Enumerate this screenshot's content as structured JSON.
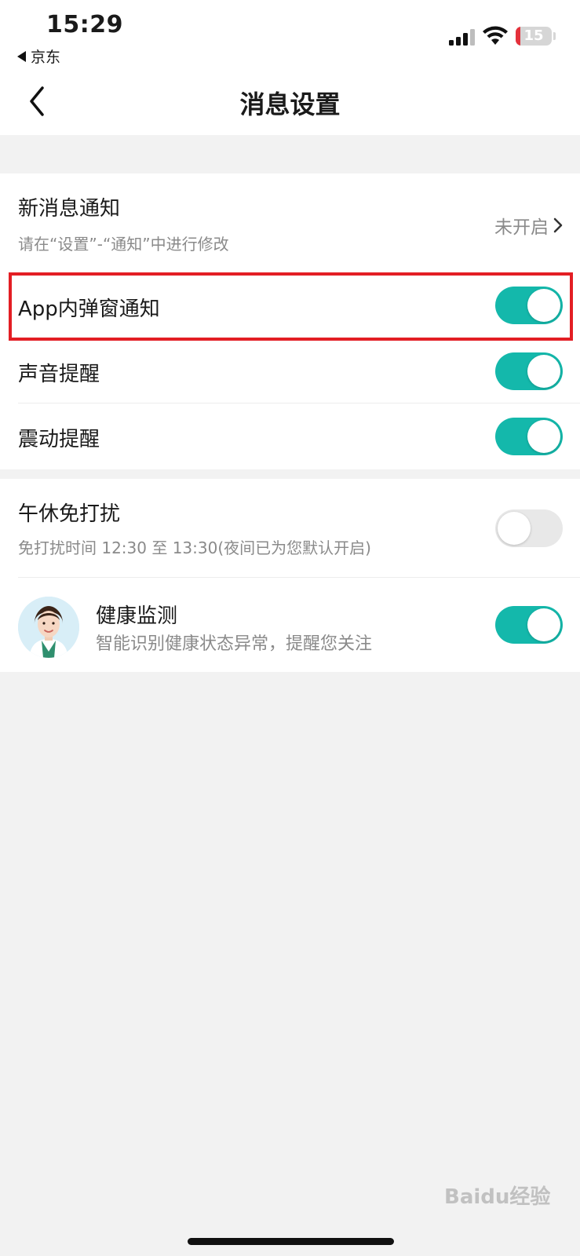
{
  "status_bar": {
    "time": "15:29",
    "back_app": "京东",
    "battery": "15",
    "icons": [
      "cellular-signal-icon",
      "wifi-icon",
      "battery-icon"
    ]
  },
  "nav": {
    "title": "消息设置",
    "back_icon": "chevron-left-icon"
  },
  "settings": {
    "new_message": {
      "title": "新消息通知",
      "subtitle": "请在“设置”-“通知”中进行修改",
      "value": "未开启"
    },
    "in_app_popup": {
      "title": "App内弹窗通知",
      "enabled": true
    },
    "sound": {
      "title": "声音提醒",
      "enabled": true
    },
    "vibration": {
      "title": "震动提醒",
      "enabled": true
    },
    "nap_dnd": {
      "title": "午休免打扰",
      "subtitle": "免打扰时间 12:30 至 13:30(夜间已为您默认开启)",
      "enabled": false
    },
    "health": {
      "title": "健康监测",
      "subtitle": "智能识别健康状态异常，提醒您关注",
      "enabled": true
    }
  },
  "colors": {
    "toggle_on": "#14b8ab",
    "toggle_off": "#e8e8e8",
    "highlight": "#e31e24"
  },
  "watermark": "Baidu经验"
}
